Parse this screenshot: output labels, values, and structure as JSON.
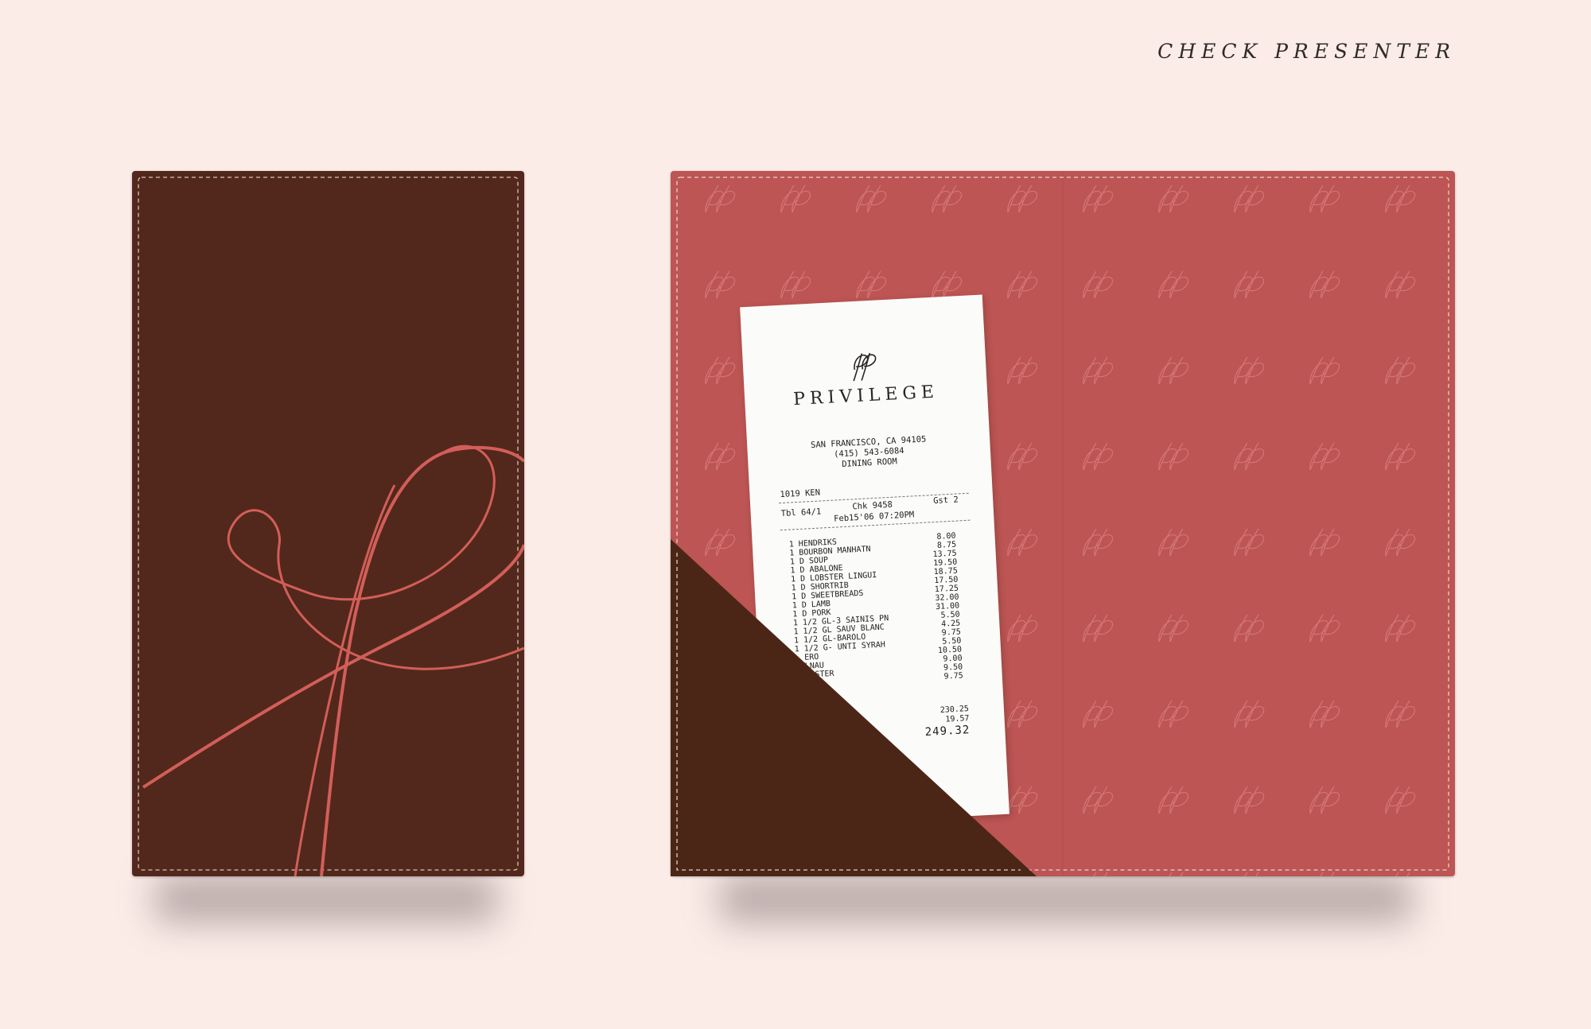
{
  "heading": "CHECK PRESENTER",
  "colors": {
    "background": "#fbece8",
    "leather_brown": "#52281c",
    "pocket_brown": "#4b2616",
    "leather_rose": "#bc5553",
    "script_line": "#d35e59",
    "stitch": "#f1ddd6"
  },
  "icons": {
    "cover_monogram": "script-p-monogram-icon",
    "pattern": "p-monogram-pattern-icon",
    "receipt_logo": "pp-monogram-icon"
  },
  "receipt": {
    "name": "PRIVILEGE",
    "address": "SAN FRANCISCO, CA 94105",
    "phone": "(415) 543-6084",
    "room": "DINING ROOM",
    "server": "1019 KEN",
    "table": "Tbl 64/1",
    "check": "Chk 9458",
    "guests": "Gst 2",
    "datetime": "Feb15'06 07:20PM",
    "items": [
      {
        "qty": "1",
        "name": "HENDRIKS",
        "price": "8.00"
      },
      {
        "qty": "1",
        "name": "BOURBON MANHATN",
        "price": "8.75"
      },
      {
        "qty": "1",
        "name": "D SOUP",
        "price": "13.75"
      },
      {
        "qty": "1",
        "name": "D ABALONE",
        "price": "19.50"
      },
      {
        "qty": "1",
        "name": "D LOBSTER LINGUI",
        "price": "18.75"
      },
      {
        "qty": "1",
        "name": "D SHORTRIB",
        "price": "17.50"
      },
      {
        "qty": "1",
        "name": "D SWEETBREADS",
        "price": "17.25"
      },
      {
        "qty": "1",
        "name": "D LAMB",
        "price": "32.00"
      },
      {
        "qty": "1",
        "name": "D PORK",
        "price": "31.00"
      },
      {
        "qty": "1",
        "name": "1/2 GL-3 SAINIS PN",
        "price": "5.50"
      },
      {
        "qty": "1",
        "name": "1/2 GL SAUV BLANC",
        "price": "4.25"
      },
      {
        "qty": "1",
        "name": "1/2 GL-BAROLO",
        "price": "9.75"
      },
      {
        "qty": "1",
        "name": "1/2 G- UNTI SYRAH",
        "price": "5.50"
      },
      {
        "qty": "",
        "name": "ERO",
        "price": "10.50"
      },
      {
        "qty": "",
        "name": "LNAU",
        "price": "9.00"
      },
      {
        "qty": "",
        "name": "FOSTER",
        "price": "9.50"
      },
      {
        "qty": "",
        "name": "",
        "price": "9.75"
      }
    ],
    "subtotal": "230.25",
    "tax": "19.57",
    "total": "249.32"
  }
}
